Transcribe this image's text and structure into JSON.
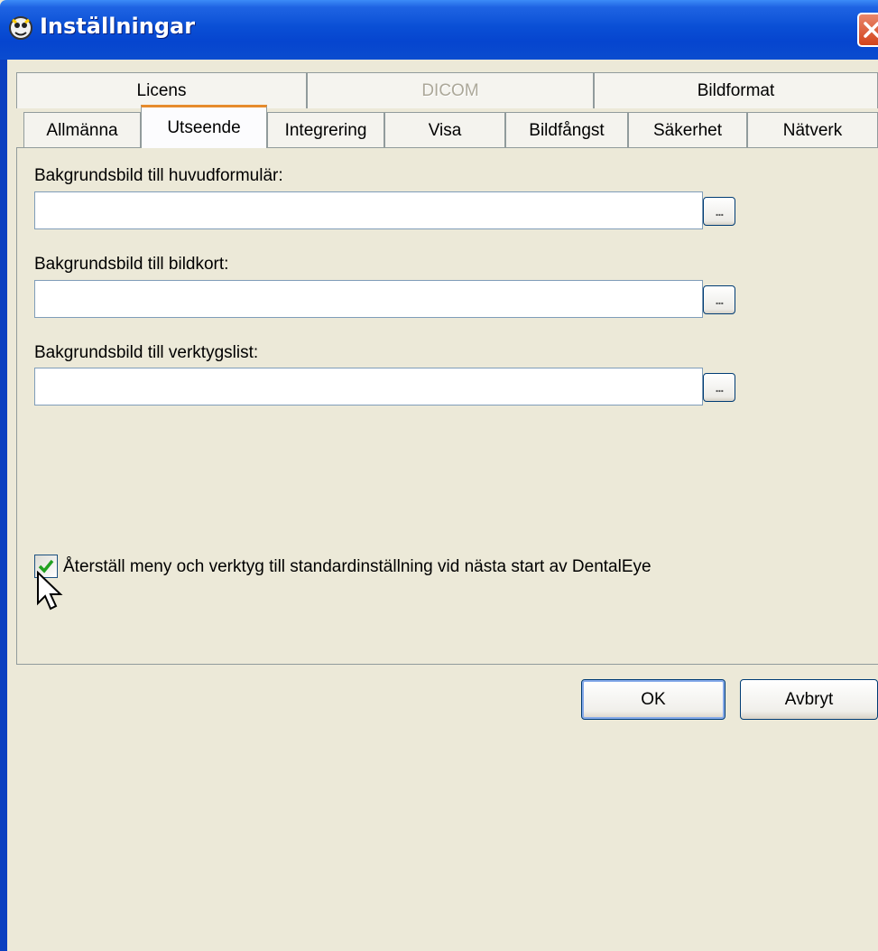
{
  "window": {
    "title": "Inställningar"
  },
  "tabs_row1": [
    {
      "label": "Licens",
      "disabled": false
    },
    {
      "label": "DICOM",
      "disabled": true
    },
    {
      "label": "Bildformat",
      "disabled": false
    }
  ],
  "tabs_row2": [
    {
      "label": "Allmänna"
    },
    {
      "label": "Utseende",
      "active": true
    },
    {
      "label": "Integrering"
    },
    {
      "label": "Visa"
    },
    {
      "label": "Bildfångst"
    },
    {
      "label": "Säkerhet"
    },
    {
      "label": "Nätverk"
    }
  ],
  "fields": [
    {
      "label": "Bakgrundsbild till huvudformulär:",
      "value": "",
      "browse": "..."
    },
    {
      "label": "Bakgrundsbild till bildkort:",
      "value": "",
      "browse": "..."
    },
    {
      "label": "Bakgrundsbild till verktygslist:",
      "value": "",
      "browse": "..."
    }
  ],
  "reset_checkbox": {
    "label": "Återställ meny och verktyg till standardinställning vid nästa start av DentalEye",
    "checked": true
  },
  "buttons": {
    "ok": "OK",
    "cancel": "Avbryt"
  },
  "colors": {
    "titlebar": "#0a4fd5",
    "active_tab_accent": "#e68b2c",
    "dialog_bg": "#ece9d8",
    "check_mark": "#21a121"
  }
}
